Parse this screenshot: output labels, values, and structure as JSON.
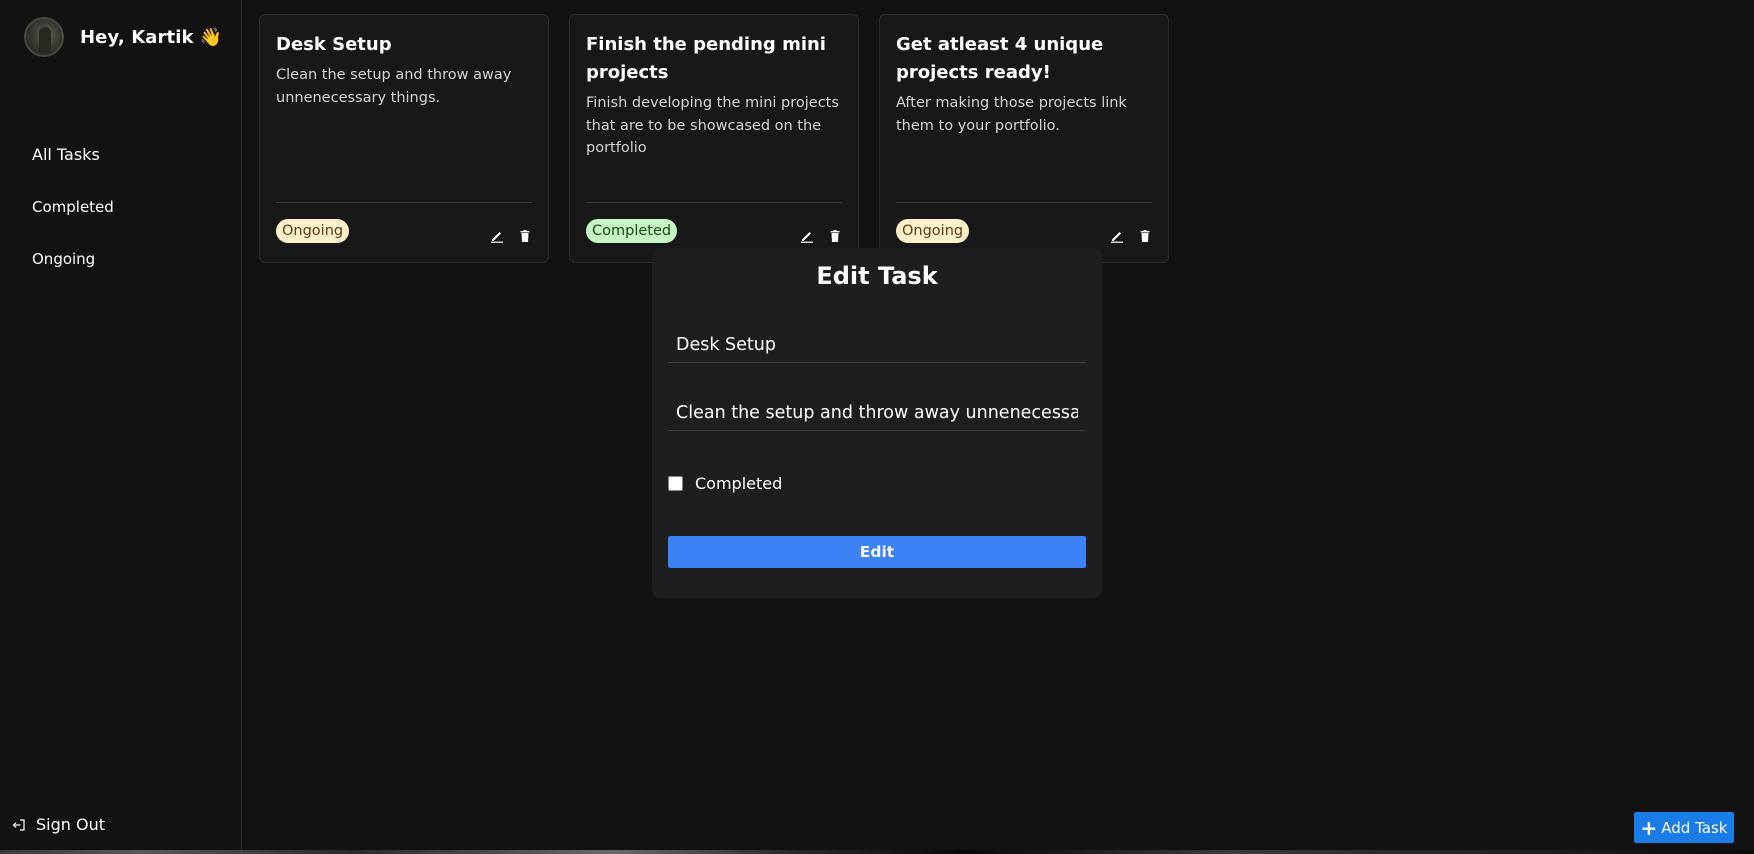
{
  "sidebar": {
    "greeting": "Hey, Kartik 👋",
    "nav": [
      {
        "label": "All Tasks"
      },
      {
        "label": "Completed"
      },
      {
        "label": "Ongoing"
      }
    ],
    "sign_out": "Sign Out"
  },
  "cards": [
    {
      "title": "Desk Setup",
      "description": "Clean the setup and throw away unnenecessary things.",
      "status": "Ongoing"
    },
    {
      "title": "Finish the pending mini projects",
      "description": "Finish developing the mini projects that are to be showcased on the portfolio",
      "status": "Completed"
    },
    {
      "title": "Get atleast 4 unique projects ready!",
      "description": "After making those projects link them to your portfolio.",
      "status": "Ongoing"
    }
  ],
  "modal": {
    "title": "Edit Task",
    "title_value": "Desk Setup",
    "description_value": "Clean the setup and throw away unnenecessary things.",
    "checkbox_label": "Completed",
    "completed_checked": false,
    "submit_label": "Edit"
  },
  "add_task": {
    "label": "Add Task"
  },
  "colors": {
    "background": "#121212",
    "card": "#181818",
    "modal": "#1e1e20",
    "primary_button": "#3b82f6",
    "add_button": "#1a7ce6",
    "badge_ongoing": "#fdf0c8",
    "badge_completed": "#c6f6c6"
  }
}
